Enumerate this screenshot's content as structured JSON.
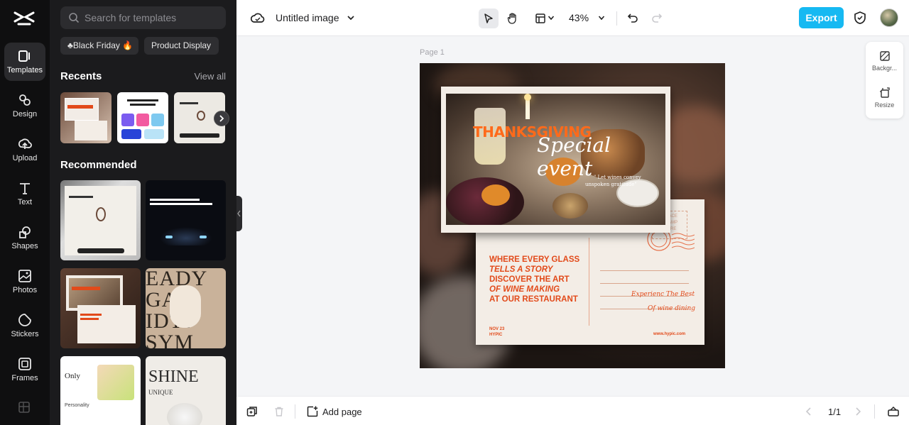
{
  "app": {
    "rail": [
      {
        "label": "Templates",
        "icon": "templates-icon"
      },
      {
        "label": "Design",
        "icon": "design-icon"
      },
      {
        "label": "Upload",
        "icon": "upload-icon"
      },
      {
        "label": "Text",
        "icon": "text-icon"
      },
      {
        "label": "Shapes",
        "icon": "shapes-icon"
      },
      {
        "label": "Photos",
        "icon": "photos-icon"
      },
      {
        "label": "Stickers",
        "icon": "stickers-icon"
      },
      {
        "label": "Frames",
        "icon": "frames-icon"
      }
    ]
  },
  "panel": {
    "search_placeholder": "Search for templates",
    "chips": [
      "♣Black Friday 🔥",
      "Product Display"
    ],
    "recents_title": "Recents",
    "view_all": "View all",
    "recommended_title": "Recommended"
  },
  "topbar": {
    "doc_title": "Untitled image",
    "zoom": "43%",
    "export_label": "Export"
  },
  "canvas": {
    "page_label": "Page 1",
    "design": {
      "headline_1": "THANKSGIVING",
      "headline_2": "Special event",
      "quote_1": "\" Let wines convey",
      "quote_2": "unspoken gratitude\"",
      "body_1": "WHERE EVERY GLASS",
      "body_2": "TELLS A STORY",
      "body_3": "DISCOVER THE ART",
      "body_4": "OF WINE MAKING",
      "body_5": "AT OUR RESTAURANT",
      "date": "NOV 23",
      "brand": "HYPIC",
      "stamp_1": "PLACE",
      "stamp_2": "STAMP",
      "stamp_3": "HERE",
      "tag_1": "Experienc The Best",
      "tag_2": "Of wine dining",
      "url": "www.hypic.com"
    }
  },
  "side_tools": {
    "background": "Backgr...",
    "resize": "Resize"
  },
  "bottombar": {
    "add_page": "Add page",
    "pager": "1/1"
  },
  "colors": {
    "accent": "#16b9f2",
    "rail_bg": "#0f0f10",
    "panel_bg": "#1b1b1d",
    "design_orange": "#e24a1a"
  }
}
